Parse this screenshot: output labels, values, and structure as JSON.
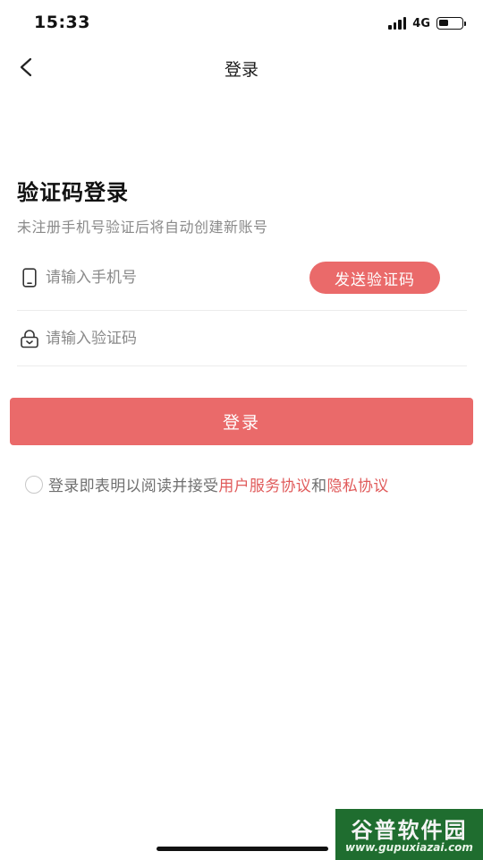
{
  "status_bar": {
    "time": "15:33",
    "network": "4G",
    "battery_level": 0.45,
    "icons": [
      "signal-icon",
      "battery-icon"
    ]
  },
  "nav": {
    "title": "登录",
    "back_icon": "chevron-left-icon"
  },
  "page": {
    "heading": "验证码登录",
    "subtitle": "未注册手机号验证后将自动创建新账号"
  },
  "form": {
    "phone": {
      "icon": "phone-icon",
      "value": "",
      "placeholder": "请输入手机号"
    },
    "send_code_label": "发送验证码",
    "code": {
      "icon": "lock-icon",
      "value": "",
      "placeholder": "请输入验证码"
    }
  },
  "login_button_label": "登录",
  "agreement": {
    "checked": false,
    "prefix": "登录即表明以阅读并接受",
    "user_agreement_link": "用户服务协议",
    "conjunction": "和",
    "privacy_link": "隐私协议"
  },
  "watermark": {
    "title": "谷普软件园",
    "url": "www.gupuxiazai.com"
  },
  "colors": {
    "accent": "#ea6a6a",
    "link": "#e05a5a",
    "watermark_bg": "#1f6d2f"
  }
}
